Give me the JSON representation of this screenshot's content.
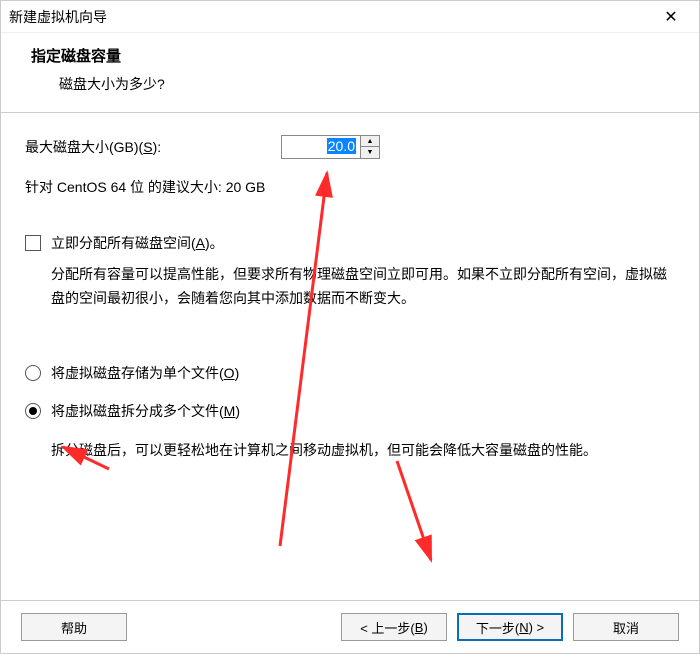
{
  "window": {
    "title": "新建虚拟机向导"
  },
  "header": {
    "title": "指定磁盘容量",
    "subtitle": "磁盘大小为多少?"
  },
  "disk_size": {
    "label_prefix": "最大磁盘大小(GB)(",
    "accel": "S",
    "label_suffix": "):",
    "value": "20.0",
    "suggestion": "针对 CentOS 64 位 的建议大小: 20 GB"
  },
  "allocate": {
    "label_prefix": "立即分配所有磁盘空间(",
    "accel": "A",
    "label_suffix": ")。",
    "checked": false,
    "desc": "分配所有容量可以提高性能，但要求所有物理磁盘空间立即可用。如果不立即分配所有空间，虚拟磁盘的空间最初很小，会随着您向其中添加数据而不断变大。"
  },
  "store_single": {
    "label_prefix": "将虚拟磁盘存储为单个文件(",
    "accel": "O",
    "label_suffix": ")",
    "checked": false
  },
  "store_split": {
    "label_prefix": "将虚拟磁盘拆分成多个文件(",
    "accel": "M",
    "label_suffix": ")",
    "checked": true,
    "desc": "拆分磁盘后，可以更轻松地在计算机之间移动虚拟机，但可能会降低大容量磁盘的性能。"
  },
  "buttons": {
    "help": "帮助",
    "back_prefix": "< 上一步(",
    "back_accel": "B",
    "back_suffix": ")",
    "next_prefix": "下一步(",
    "next_accel": "N",
    "next_suffix": ") >",
    "cancel": "取消"
  }
}
